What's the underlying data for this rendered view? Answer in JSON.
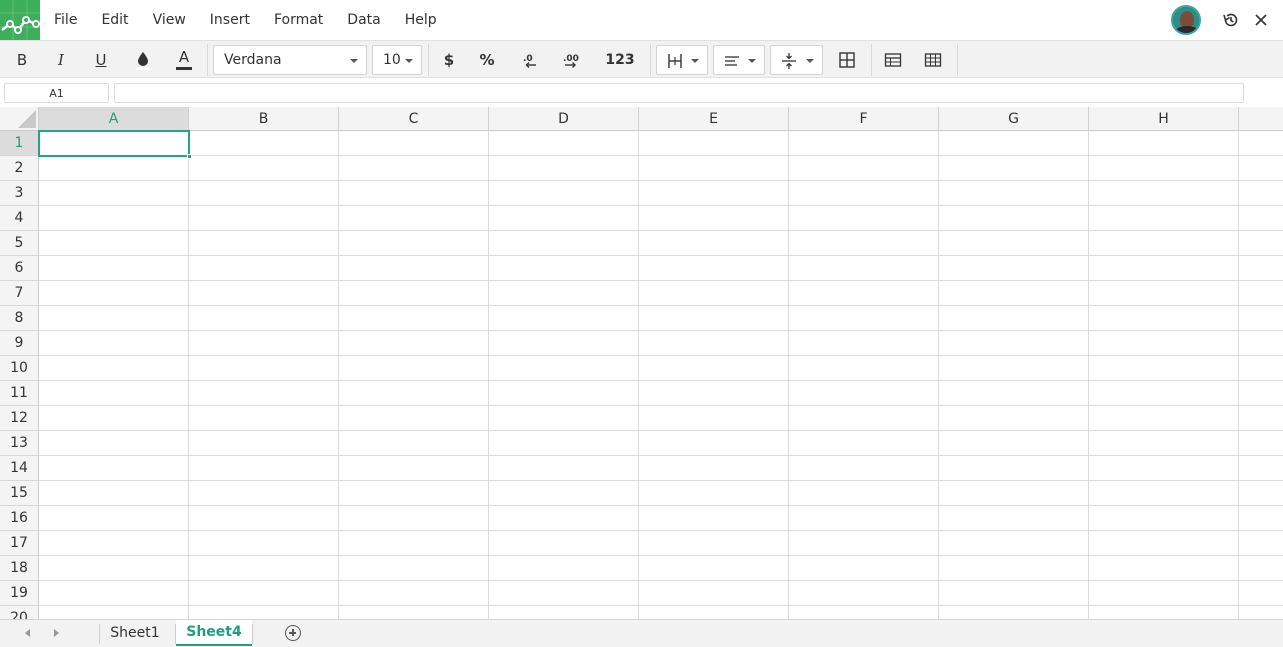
{
  "menu": {
    "items": [
      {
        "id": "file",
        "label": "File"
      },
      {
        "id": "edit",
        "label": "Edit"
      },
      {
        "id": "view",
        "label": "View"
      },
      {
        "id": "insert",
        "label": "Insert"
      },
      {
        "id": "format",
        "label": "Format"
      },
      {
        "id": "data",
        "label": "Data"
      },
      {
        "id": "help",
        "label": "Help"
      }
    ]
  },
  "toolbar": {
    "bold": "B",
    "italic": "I",
    "underline": "U",
    "text_color_letter": "A",
    "font_family": "Verdana",
    "font_size": "10",
    "currency": "$",
    "percent": "%",
    "number_format": "123"
  },
  "formula_bar": {
    "cell_ref": "A1",
    "value": ""
  },
  "grid": {
    "columns": [
      "A",
      "B",
      "C",
      "D",
      "E",
      "F",
      "G",
      "H"
    ],
    "rows": [
      "1",
      "2",
      "3",
      "4",
      "5",
      "6",
      "7",
      "8",
      "9",
      "10",
      "11",
      "12",
      "13",
      "14",
      "15",
      "16",
      "17",
      "18",
      "19",
      "20"
    ],
    "active_column": "A",
    "active_row": "1"
  },
  "sheets": {
    "tabs": [
      {
        "label": "Sheet1",
        "active": false
      },
      {
        "label": "Sheet4",
        "active": true
      }
    ]
  },
  "colors": {
    "brand": "#3cae5c",
    "accent": "#1d9e7c",
    "selection": "#2ba382"
  }
}
